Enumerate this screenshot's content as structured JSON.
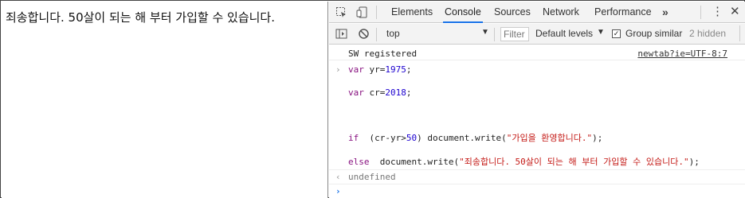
{
  "page": {
    "message": "죄송합니다. 50살이 되는 해 부터 가입할 수 있습니다."
  },
  "devtools": {
    "tabs": [
      {
        "label": "Elements"
      },
      {
        "label": "Console"
      },
      {
        "label": "Sources"
      },
      {
        "label": "Network"
      },
      {
        "label": "Performance"
      }
    ],
    "more_tabs": "»",
    "menu": "⋮",
    "close": "✕",
    "toolbar": {
      "context": "top",
      "filter_placeholder": "Filter",
      "levels": "Default levels",
      "group_similar_label": "Group similar",
      "group_similar_checked": true,
      "hidden_count": "2 hidden"
    },
    "console": {
      "log_text": "SW registered",
      "log_source": "newtab?ie=UTF-8:7",
      "code_lines": [
        "var yr=1975;",
        "",
        "var cr=2018;",
        "",
        "",
        "",
        "if  (cr-yr>50) document.write(\"가입을 환영합니다.\");",
        "",
        "else  document.write(\"죄송합니다. 50살이 되는 해 부터 가입할 수 있습니다.\");"
      ],
      "result": "undefined",
      "input_arrow": "›",
      "result_arrow": "‹"
    }
  }
}
